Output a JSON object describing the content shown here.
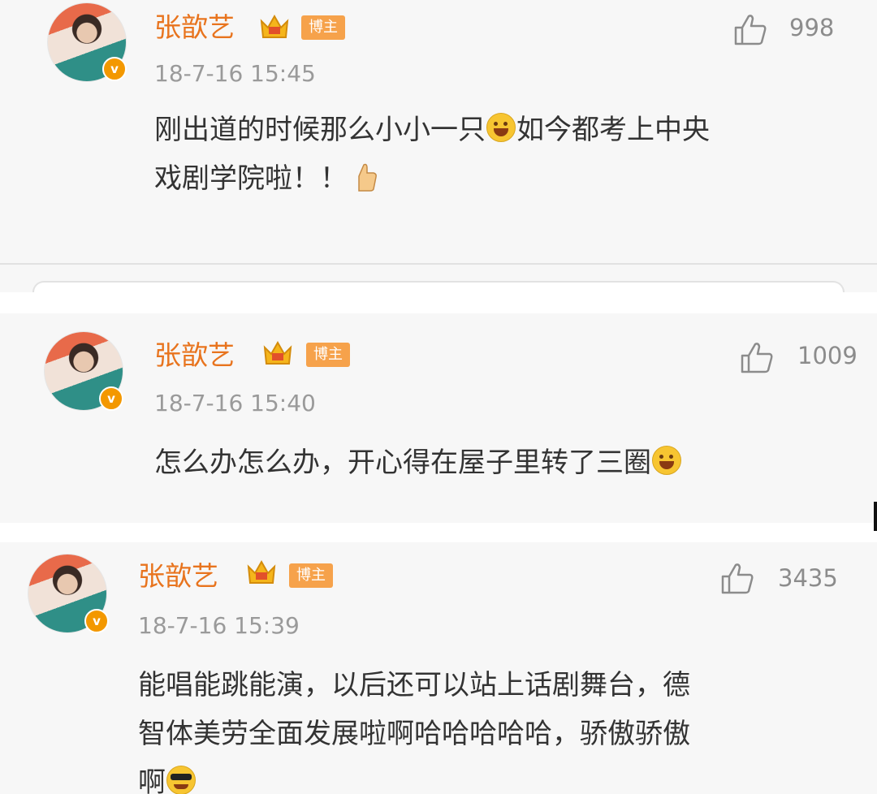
{
  "comments": [
    {
      "username": "张歆艺",
      "badge": "博主",
      "verified_mark": "v",
      "timestamp": "18-7-16 15:45",
      "likes": "998",
      "text_parts": [
        "刚出道的时候那么小小一只",
        "如今都考上中央",
        "戏剧学院啦！！"
      ],
      "emojis": [
        "laugh-cry-emoji",
        "thumbs-up-emoji"
      ]
    },
    {
      "username": "张歆艺",
      "badge": "博主",
      "verified_mark": "v",
      "timestamp": "18-7-16 15:40",
      "likes": "1009",
      "text_parts": [
        "怎么办怎么办，开心得在屋子里转了三圈"
      ],
      "emojis": [
        "grin-emoji"
      ]
    },
    {
      "username": "张歆艺",
      "badge": "博主",
      "verified_mark": "v",
      "timestamp": "18-7-16 15:39",
      "likes": "3435",
      "text_parts": [
        "能唱能跳能演，以后还可以站上话剧舞台，德",
        "智体美劳全面发展啦啊哈哈哈哈哈，骄傲骄傲",
        "啊"
      ],
      "emojis": [
        "sunglasses-emoji"
      ]
    }
  ],
  "colors": {
    "username": "#e8741e",
    "badge_bg": "#f6a24b",
    "verified": "#f39800",
    "panel_bg": "#f7f7f7",
    "timestamp": "#9a9a9a",
    "comment_text": "#333333"
  },
  "icons": {
    "like": "thumbs-up-outline-icon",
    "crown": "crown-icon",
    "verified": "verified-v-icon"
  }
}
